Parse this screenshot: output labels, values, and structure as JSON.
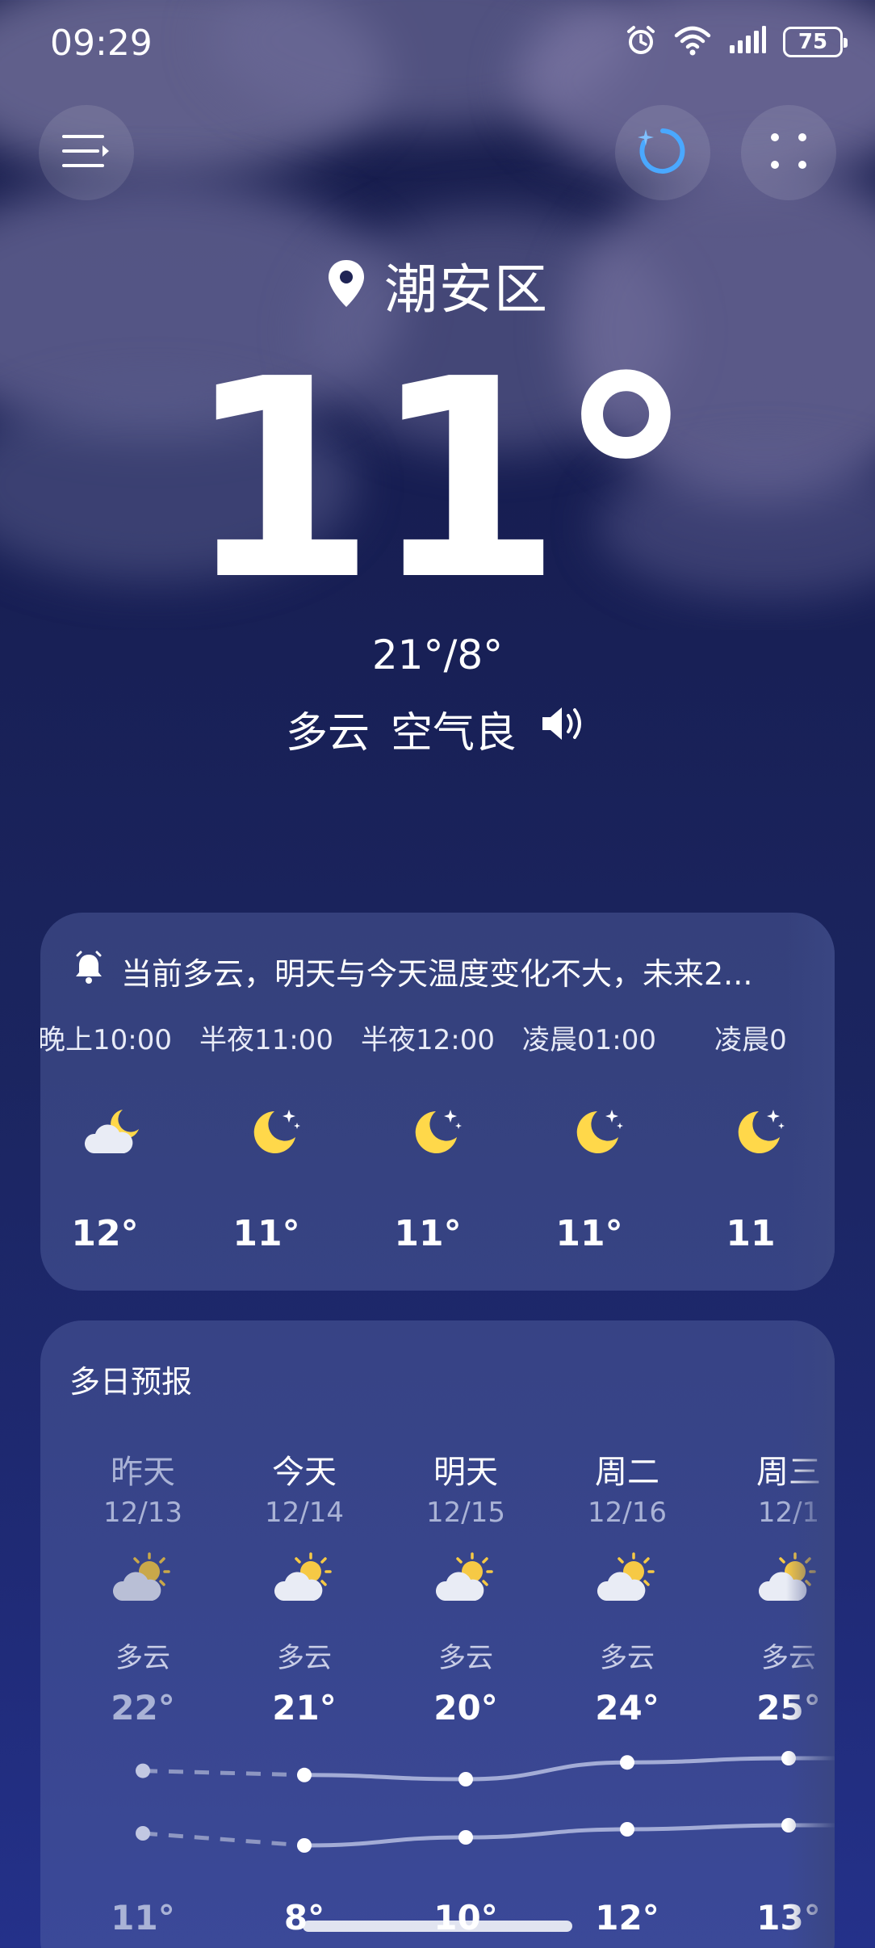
{
  "status_bar": {
    "time": "09:29",
    "battery": "75",
    "icons": [
      "alarm-icon",
      "wifi-icon",
      "signal-icon",
      "battery-icon"
    ]
  },
  "toolbar": {
    "menu_icon": "menu-icon",
    "refresh_icon": "refresh-icon",
    "more_icon": "more-icon"
  },
  "location": {
    "name": "潮安区",
    "icon": "location-pin-icon"
  },
  "current": {
    "temperature": "11°",
    "range": "21°/8°",
    "condition": "多云",
    "air_quality": "空气良",
    "speaker_icon": "speaker-icon"
  },
  "hourly_card": {
    "alert": "当前多云，明天与今天温度变化不大，未来2...",
    "hours": [
      {
        "time": "晚上10:00",
        "temp": "12°",
        "icon": "cloudy-night-icon"
      },
      {
        "time": "半夜11:00",
        "temp": "11°",
        "icon": "clear-night-icon"
      },
      {
        "time": "半夜12:00",
        "temp": "11°",
        "icon": "clear-night-icon"
      },
      {
        "time": "凌晨01:00",
        "temp": "11°",
        "icon": "clear-night-icon"
      },
      {
        "time": "凌晨0",
        "temp": "11",
        "icon": "clear-night-icon"
      }
    ]
  },
  "forecast_card": {
    "title": "多日预报",
    "days": [
      {
        "name": "昨天",
        "date": "12/13",
        "desc": "多云",
        "high": "22°",
        "low": "11°",
        "high_value": 22,
        "low_value": 11
      },
      {
        "name": "今天",
        "date": "12/14",
        "desc": "多云",
        "high": "21°",
        "low": "8°",
        "high_value": 21,
        "low_value": 8
      },
      {
        "name": "明天",
        "date": "12/15",
        "desc": "多云",
        "high": "20°",
        "low": "10°",
        "high_value": 20,
        "low_value": 10
      },
      {
        "name": "周二",
        "date": "12/16",
        "desc": "多云",
        "high": "24°",
        "low": "12°",
        "high_value": 24,
        "low_value": 12
      },
      {
        "name": "周三",
        "date": "12/1",
        "desc": "多云",
        "high": "25°",
        "low": "13°",
        "high_value": 25,
        "low_value": 13
      }
    ]
  },
  "colors": {
    "background_top": "#1a1f4d",
    "background_bottom": "#24318a",
    "card": "#4a5596",
    "accent_blue": "#4aa8ff",
    "moon_yellow": "#ffd84a",
    "sun_yellow": "#f6c945"
  }
}
